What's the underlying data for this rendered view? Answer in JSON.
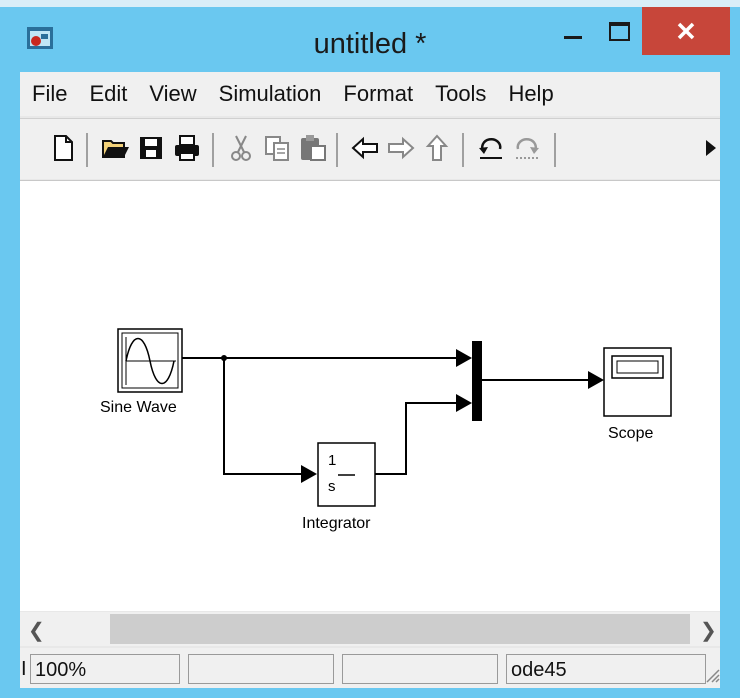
{
  "window": {
    "title": "untitled *",
    "app_icon": "simulink-model-icon",
    "controls": [
      "minimize-icon",
      "maximize-icon",
      "close-icon"
    ],
    "title_bar_color": "#6ac8f0",
    "close_color": "#c7463a"
  },
  "menu": {
    "items": [
      "File",
      "Edit",
      "View",
      "Simulation",
      "Format",
      "Tools",
      "Help"
    ]
  },
  "toolbar": {
    "icons": [
      "new-file-icon",
      "open-folder-icon",
      "save-icon",
      "print-icon",
      "cut-icon",
      "copy-icon",
      "paste-icon",
      "back-icon",
      "forward-icon",
      "up-icon",
      "undo-icon",
      "redo-icon",
      "start-simulation-icon"
    ]
  },
  "diagram": {
    "blocks": {
      "sine_wave": {
        "label": "Sine Wave"
      },
      "integrator": {
        "label": "Integrator",
        "numerator": "1",
        "denominator": "s"
      },
      "mux": {
        "label": ""
      },
      "scope": {
        "label": "Scope"
      }
    }
  },
  "status": {
    "prefix": "I",
    "zoom": "100%",
    "field2": "",
    "field3": "",
    "solver": "ode45"
  }
}
